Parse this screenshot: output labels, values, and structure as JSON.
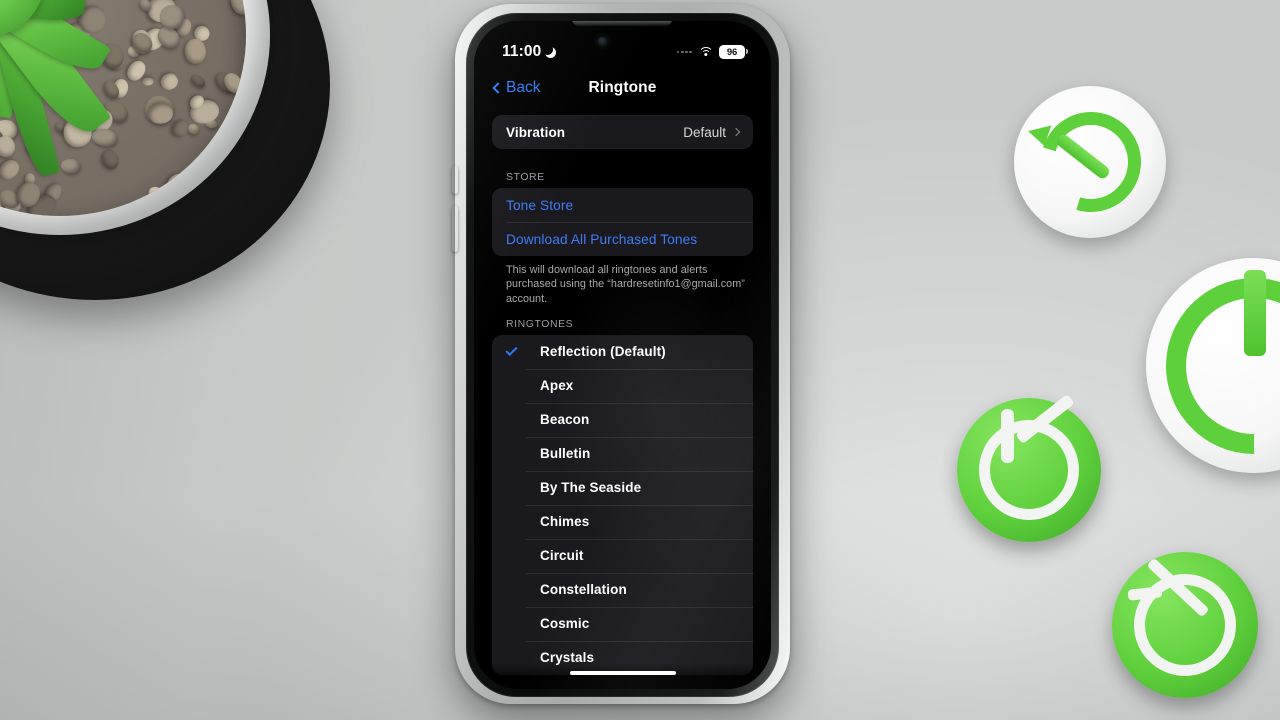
{
  "scene": {
    "description": "iPhone on a light gray desk showing iOS Settings Ringtone screen, succulent plant top-left, green 3D-printed power and reset icons on the right"
  },
  "status_bar": {
    "time": "11:00",
    "moon_icon": "crescent-moon-icon",
    "signal_icon": "cellular-dots-icon",
    "wifi_icon": "wifi-icon",
    "battery_percent": "96"
  },
  "nav_bar": {
    "back_label": "Back",
    "back_icon": "chevron-left-icon",
    "title": "Ringtone"
  },
  "vibration": {
    "label": "Vibration",
    "value": "Default",
    "chevron_icon": "chevron-right-icon"
  },
  "store": {
    "header": "STORE",
    "items": [
      {
        "label": "Tone Store"
      },
      {
        "label": "Download All Purchased Tones"
      }
    ],
    "footnote": "This will download all ringtones and alerts purchased using the “hardresetinfo1@gmail.com” account."
  },
  "ringtones": {
    "header": "RINGTONES",
    "check_icon": "checkmark-icon",
    "items": [
      {
        "name": "Reflection (Default)",
        "selected": true
      },
      {
        "name": "Apex",
        "selected": false
      },
      {
        "name": "Beacon",
        "selected": false
      },
      {
        "name": "Bulletin",
        "selected": false
      },
      {
        "name": "By The Seaside",
        "selected": false
      },
      {
        "name": "Chimes",
        "selected": false
      },
      {
        "name": "Circuit",
        "selected": false
      },
      {
        "name": "Constellation",
        "selected": false
      },
      {
        "name": "Cosmic",
        "selected": false
      },
      {
        "name": "Crystals",
        "selected": false
      }
    ]
  },
  "home_indicator": "home-indicator",
  "colors": {
    "accent_blue": "#2f7cf6",
    "link_blue": "#3f7df7",
    "group_bg": "#1a191d",
    "screen_bg": "#000000",
    "desk": "#d9dbda",
    "prop_green": "#5ed03b"
  },
  "props": {
    "plant": "succulent-plant",
    "icon_reset_top": "reset-arrow-icon-prop",
    "icon_power_large": "power-icon-prop-large",
    "icon_power_small": "power-icon-prop-small",
    "icon_reset_bottom": "reset-arrow-icon-prop-bottom"
  }
}
